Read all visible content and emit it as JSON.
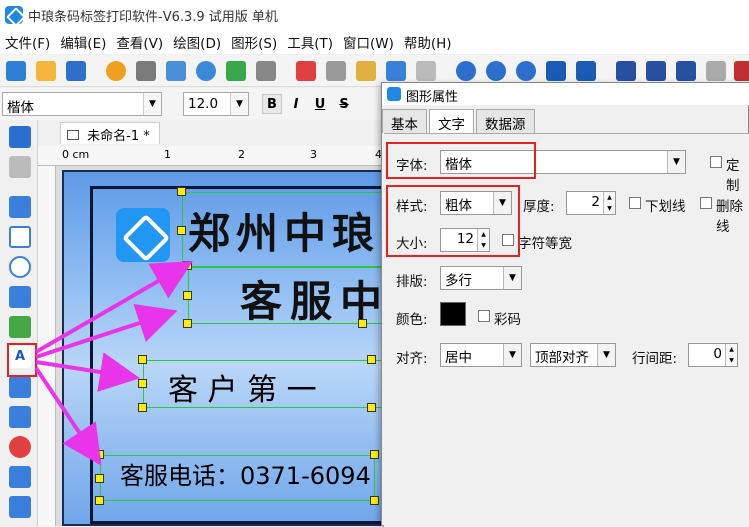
{
  "titlebar": {
    "title": "中琅条码标签打印软件-V6.3.9 试用版 单机"
  },
  "menu": [
    "文件(F)",
    "编辑(E)",
    "查看(V)",
    "绘图(D)",
    "图形(S)",
    "工具(T)",
    "窗口(W)",
    "帮助(H)"
  ],
  "toolbar2": {
    "font": "楷体",
    "size": "12.0",
    "bold": "B",
    "italic": "I",
    "underline": "U",
    "strike": "S"
  },
  "doc_tab": "未命名-1 *",
  "ruler": {
    "unit": "0 cm",
    "ticks": [
      "1",
      "2",
      "3",
      "4"
    ]
  },
  "label_canvas": {
    "line1": "郑州中琅",
    "line2": "客服中",
    "line3": "客 户 第 一",
    "line4": "客服电话：0371-6094"
  },
  "dialog": {
    "title": "图形属性",
    "tabs": [
      "基本",
      "文字",
      "数据源"
    ],
    "font_label": "字体:",
    "font_value": "楷体",
    "custom_label": "定制",
    "style_label": "样式:",
    "style_value": "粗体",
    "thickness_label": "厚度:",
    "thickness_value": "2",
    "underline_label": "下划线",
    "strike_label": "删除线",
    "size_label": "大小:",
    "size_value": "12",
    "monospace_label": "字符等宽",
    "layout_label": "排版:",
    "layout_value": "多行",
    "color_label": "颜色:",
    "color_value": "#000000",
    "colorful_label": "彩码",
    "align_label": "对齐:",
    "align_value": "居中",
    "valign_value": "顶部对齐",
    "linespacing_label": "行间距:",
    "linespacing_value": "0"
  },
  "colors": {
    "accent": "#e52222",
    "arrow": "#e935e9",
    "handle": "#ffee00"
  }
}
